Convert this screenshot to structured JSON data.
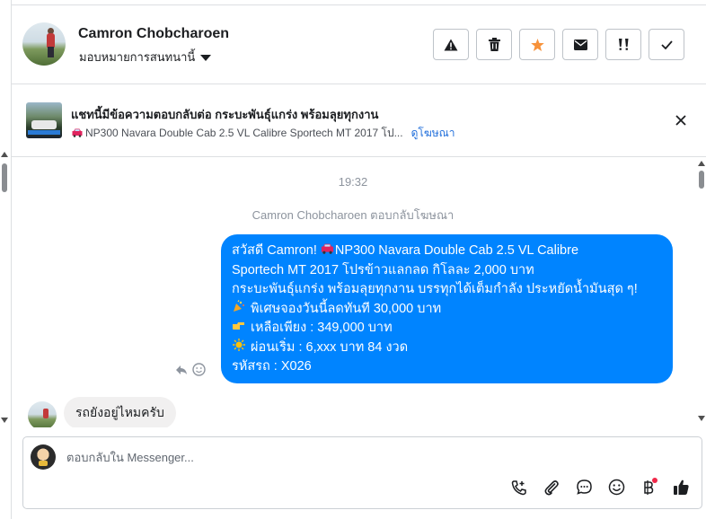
{
  "header": {
    "user_name": "Camron Chobcharoen",
    "assign_label": "มอบหมายการสนทนานี้",
    "actions": [
      "report-icon",
      "trash-icon",
      "star-icon",
      "envelope-icon",
      "follow-up-icon",
      "check-icon"
    ]
  },
  "banner": {
    "title": "แชทนี้มีข้อความตอบกลับต่อ กระบะพันธุ์แกร่ง พร้อมลุยทุกงาน",
    "subtitle": "NP300 Navara Double Cab 2.5 VL Calibre Sportech MT 2017 โป...",
    "link_label": "ดูโฆษณา"
  },
  "conversation": {
    "timestamp": "19:32",
    "replied_note": "Camron Chobcharoen ตอบกลับโฆษณา",
    "outgoing": {
      "line1": "สวัสดี Camron! ",
      "line1_rest": "NP300 Navara Double Cab 2.5 VL Calibre",
      "line2": "Sportech MT 2017 โปรข้าวแลกลด กิโลละ 2,000 บาท",
      "line3": "กระบะพันธุ์แกร่ง พร้อมลุยทุกงาน บรรทุกได้เต็มกำลัง ประหยัดน้ำมันสุด ๆ!",
      "line4": "พิเศษจองวันนี้ลดทันที 30,000 บาท",
      "line5": "เหลือเพียง : 349,000 บาท",
      "line6": "ผ่อนเริ่ม : 6,xxx บาท 84 งวด",
      "line7": "รหัสรถ : X026"
    },
    "incoming": {
      "text": "รถยังอยู่ไหมครับ"
    }
  },
  "composer": {
    "placeholder": "ตอบกลับใน Messenger...",
    "tools": [
      "call-icon",
      "attachment-icon",
      "saved-replies-icon",
      "emoji-icon",
      "baht-payment-icon",
      "thumbs-up-icon"
    ]
  },
  "colors": {
    "messenger_blue": "#0084ff",
    "star_orange": "#f7923a",
    "link_blue": "#216fdb",
    "incoming_bubble": "#f1f0f0",
    "notification_red": "#f02849"
  }
}
